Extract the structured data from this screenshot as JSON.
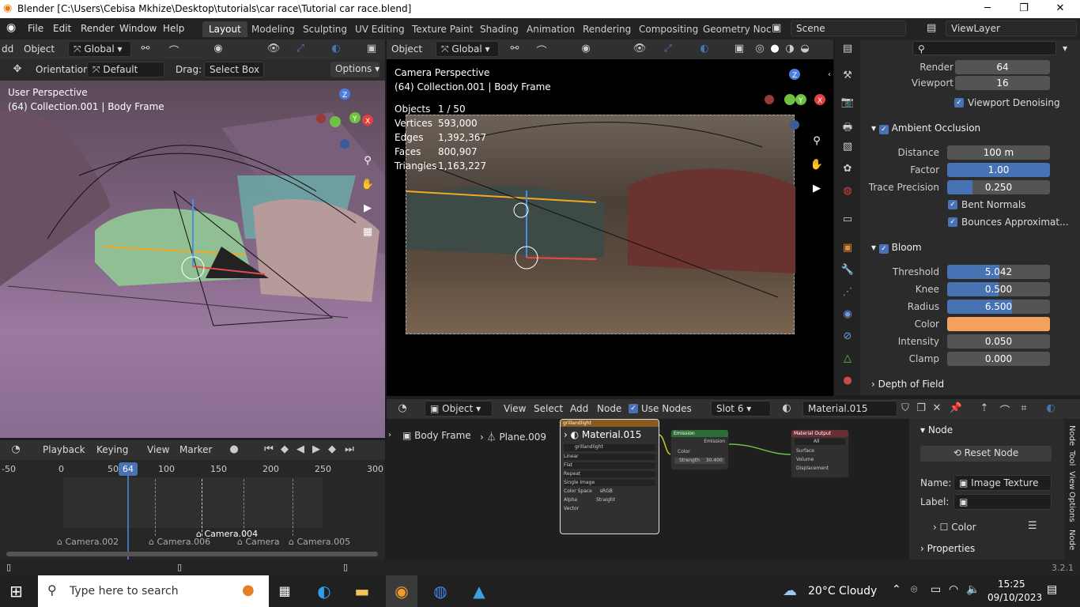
{
  "window": {
    "title": "Blender [C:\\Users\\Cebisa Mkhize\\Desktop\\tutorials\\car race\\Tutorial car race.blend]"
  },
  "menu": [
    "File",
    "Edit",
    "Render",
    "Window",
    "Help"
  ],
  "workspaces": [
    "Layout",
    "Modeling",
    "Sculpting",
    "UV Editing",
    "Texture Paint",
    "Shading",
    "Animation",
    "Rendering",
    "Compositing",
    "Geometry Noc"
  ],
  "scene": {
    "name": "Scene",
    "view_layer": "ViewLayer"
  },
  "left_viewport": {
    "header": {
      "add": "dd",
      "object": "Object",
      "transform": "Global"
    },
    "tool": {
      "orientation_label": "Orientation:",
      "orientation_value": "Default",
      "drag_label": "Drag:",
      "drag_value": "Select Box",
      "options": "Options"
    },
    "overlay_title": "User Perspective",
    "overlay_subtitle": "(64) Collection.001 | Body Frame"
  },
  "right_viewport": {
    "header": {
      "object": "Object",
      "transform": "Global"
    },
    "overlay_title": "Camera Perspective",
    "overlay_subtitle": "(64) Collection.001 | Body Frame",
    "stats": [
      {
        "label": "Objects",
        "value": "1 / 50"
      },
      {
        "label": "Vertices",
        "value": "593,000"
      },
      {
        "label": "Edges",
        "value": "1,392,367"
      },
      {
        "label": "Faces",
        "value": "800,907"
      },
      {
        "label": "Triangles",
        "value": "1,163,227"
      }
    ]
  },
  "properties": {
    "search_placeholder": "",
    "render": {
      "label": "Render",
      "value": "64"
    },
    "viewport": {
      "label": "Viewport",
      "value": "16"
    },
    "viewport_denoising": "Viewport Denoising",
    "ambient_occlusion": {
      "title": "Ambient Occlusion",
      "distance": {
        "label": "Distance",
        "value": "100 m"
      },
      "factor": {
        "label": "Factor",
        "value": "1.00",
        "fraction": 1.0
      },
      "trace_precision": {
        "label": "Trace Precision",
        "value": "0.250",
        "fraction": 0.25
      },
      "bent_normals": "Bent Normals",
      "bounces": "Bounces Approximat..."
    },
    "bloom": {
      "title": "Bloom",
      "threshold": {
        "label": "Threshold",
        "value": "5.042",
        "fraction": 0.51
      },
      "knee": {
        "label": "Knee",
        "value": "0.500",
        "fraction": 0.5
      },
      "radius": {
        "label": "Radius",
        "value": "6.500",
        "fraction": 0.63
      },
      "color": {
        "label": "Color",
        "value": "#f4a15c"
      },
      "intensity": {
        "label": "Intensity",
        "value": "0.050",
        "fraction": 0.0
      },
      "clamp": {
        "label": "Clamp",
        "value": "0.000",
        "fraction": 0.0
      }
    },
    "depth_of_field": "Depth of Field"
  },
  "timeline": {
    "playback": "Playback",
    "keying": "Keying",
    "view": "View",
    "marker": "Marker",
    "current_frame": "64",
    "ticks": [
      "-50",
      "0",
      "50",
      "100",
      "150",
      "200",
      "250",
      "300"
    ],
    "markers": [
      "Camera.002",
      "Camera.006",
      "Camera.004",
      "Camera",
      "Camera.005"
    ]
  },
  "node_editor": {
    "header": {
      "object": "Object",
      "view": "View",
      "select": "Select",
      "add": "Add",
      "node": "Node",
      "use_nodes": "Use Nodes",
      "slot": "Slot 6",
      "material": "Material.015"
    },
    "breadcrumb": {
      "object": "Body Frame",
      "mesh": "Plane.009",
      "material": "Material.015"
    },
    "image_node": {
      "title": "grillandlight",
      "image": "grillandlight",
      "rows": [
        "Linear",
        "Flat",
        "Repeat",
        "Single Image",
        "Color Space",
        "Alpha",
        "Vector"
      ],
      "color_space": "sRGB",
      "alpha": "Straight",
      "out_color": "Color",
      "out_alpha": "Alpha"
    },
    "emission_node": {
      "title": "Emission",
      "out": "Emission",
      "color": "Color",
      "strength_label": "Strength",
      "strength": "30.400"
    },
    "output_node": {
      "title": "Material Output",
      "target": "All",
      "surface": "Surface",
      "volume": "Volume",
      "displacement": "Displacement"
    },
    "sidebar": {
      "section": "Node",
      "reset": "Reset Node",
      "name_label": "Name:",
      "name_value": "Image Texture",
      "label_label": "Label:",
      "label_value": "",
      "color": "Color",
      "properties": "Properties",
      "tabs": [
        "Node",
        "Tool",
        "View",
        "Options",
        "Node"
      ]
    }
  },
  "status": {
    "version": "3.2.1"
  },
  "taskbar": {
    "search_placeholder": "Type here to search",
    "weather": "20°C  Cloudy",
    "time": "15:25",
    "date": "09/10/2023"
  },
  "colors": {
    "accent": "#4772b3",
    "bloom_color": "#f4a15c",
    "header_bg": "#303030",
    "panel_bg": "#2b2b2b"
  }
}
